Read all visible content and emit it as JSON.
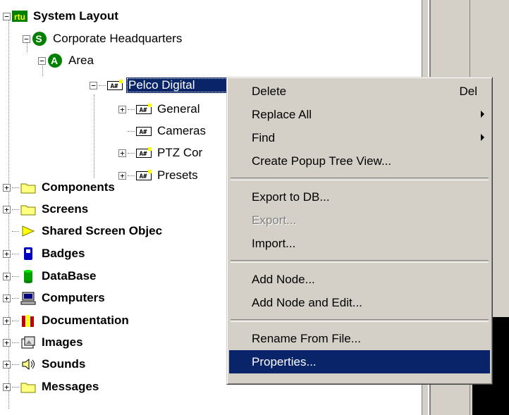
{
  "tree": {
    "root": {
      "label": "System Layout",
      "expander": "−"
    },
    "hq": {
      "label": "Corporate Headquarters",
      "expander": "−"
    },
    "area": {
      "label": "Area",
      "expander": "−"
    },
    "pelco": {
      "label": "Pelco Digital",
      "expander": "−"
    },
    "pelco_children": [
      {
        "label": "General",
        "expander": "+"
      },
      {
        "label": "Cameras",
        "expander": ""
      },
      {
        "label": "PTZ Cor",
        "expander": "+"
      },
      {
        "label": "Presets",
        "expander": "+"
      }
    ],
    "top_items": [
      {
        "label": "Components",
        "expander": "+",
        "icon": "folder-icon"
      },
      {
        "label": "Screens",
        "expander": "+",
        "icon": "folder-icon"
      },
      {
        "label": "Shared Screen Objec",
        "expander": "",
        "icon": "triangle-icon"
      },
      {
        "label": "Badges",
        "expander": "+",
        "icon": "badge-icon"
      },
      {
        "label": "DataBase",
        "expander": "+",
        "icon": "database-icon"
      },
      {
        "label": "Computers",
        "expander": "+",
        "icon": "computer-icon"
      },
      {
        "label": "Documentation",
        "expander": "+",
        "icon": "books-icon"
      },
      {
        "label": "Images",
        "expander": "+",
        "icon": "images-icon"
      },
      {
        "label": "Sounds",
        "expander": "+",
        "icon": "speaker-icon"
      },
      {
        "label": "Messages",
        "expander": "+",
        "icon": "folder-icon"
      }
    ]
  },
  "context_menu": {
    "delete": {
      "label": "Delete",
      "shortcut": "Del"
    },
    "replace_all": {
      "label": "Replace All"
    },
    "find": {
      "label": "Find"
    },
    "create_popup": {
      "label": "Create Popup Tree View..."
    },
    "export_db": {
      "label": "Export to DB..."
    },
    "export": {
      "label": "Export..."
    },
    "import": {
      "label": "Import..."
    },
    "add_node": {
      "label": "Add Node..."
    },
    "add_node_edit": {
      "label": "Add Node and Edit..."
    },
    "rename_file": {
      "label": "Rename From File..."
    },
    "properties": {
      "label": "Properties..."
    }
  },
  "icon_texts": {
    "rtu": "rtu",
    "hq": "S",
    "area": "A",
    "node": "A#"
  },
  "colors": {
    "selection": "#0a246a",
    "menu_bg": "#d4d0c8"
  }
}
